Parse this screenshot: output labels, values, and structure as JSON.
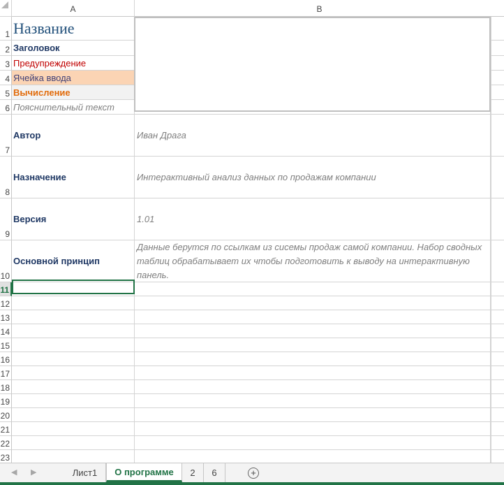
{
  "columns": [
    "A",
    "B"
  ],
  "rows": [
    {
      "num": "1",
      "a": "Название",
      "a_style": "title",
      "b": ""
    },
    {
      "num": "2",
      "a": "Заголовок",
      "a_style": "heading",
      "b": ""
    },
    {
      "num": "3",
      "a": "Предупреждение",
      "a_style": "warn",
      "b": ""
    },
    {
      "num": "4",
      "a": "Ячейка ввода",
      "a_style": "input",
      "b": ""
    },
    {
      "num": "5",
      "a": "Вычисление",
      "a_style": "calc",
      "b": ""
    },
    {
      "num": "6",
      "a": "Пояснительный текст",
      "a_style": "expl",
      "b": ""
    },
    {
      "num": "7",
      "a": "Автор",
      "a_style": "label",
      "b": "Иван Драга"
    },
    {
      "num": "8",
      "a": "Назначение",
      "a_style": "label",
      "b": "Интерактивный анализ данных по продажам компании"
    },
    {
      "num": "9",
      "a": "Версия",
      "a_style": "label",
      "b": "1.01"
    },
    {
      "num": "10",
      "a": "Основной принцип",
      "a_style": "label",
      "b": "Данные берутся по ссылкам из сисемы продаж самой компании. Набор сводных таблиц обрабатывает их чтобы подготовить к выводу на интерактивную панель."
    },
    {
      "num": "11",
      "a": "",
      "b": ""
    },
    {
      "num": "12",
      "a": "",
      "b": ""
    },
    {
      "num": "13",
      "a": "",
      "b": ""
    },
    {
      "num": "14",
      "a": "",
      "b": ""
    },
    {
      "num": "15",
      "a": "",
      "b": ""
    },
    {
      "num": "16",
      "a": "",
      "b": ""
    },
    {
      "num": "17",
      "a": "",
      "b": ""
    },
    {
      "num": "18",
      "a": "",
      "b": ""
    },
    {
      "num": "19",
      "a": "",
      "b": ""
    },
    {
      "num": "20",
      "a": "",
      "b": ""
    },
    {
      "num": "21",
      "a": "",
      "b": ""
    },
    {
      "num": "22",
      "a": "",
      "b": ""
    },
    {
      "num": "23",
      "a": "",
      "b": ""
    }
  ],
  "selected_row": "11",
  "sheet_tabs": [
    {
      "label": "Лист1",
      "active": false
    },
    {
      "label": "О программе",
      "active": true
    },
    {
      "label": "2",
      "active": false
    },
    {
      "label": "6",
      "active": false
    }
  ],
  "nav": {
    "prev": "◀",
    "next": "▶"
  },
  "add_sheet_symbol": "+",
  "colors": {
    "accent": "#217346",
    "title": "#1f4e79",
    "warning": "#c00000",
    "input_fill": "#fbd4b4",
    "calc_text": "#e26b0a",
    "explanatory": "#7f7f7f"
  }
}
